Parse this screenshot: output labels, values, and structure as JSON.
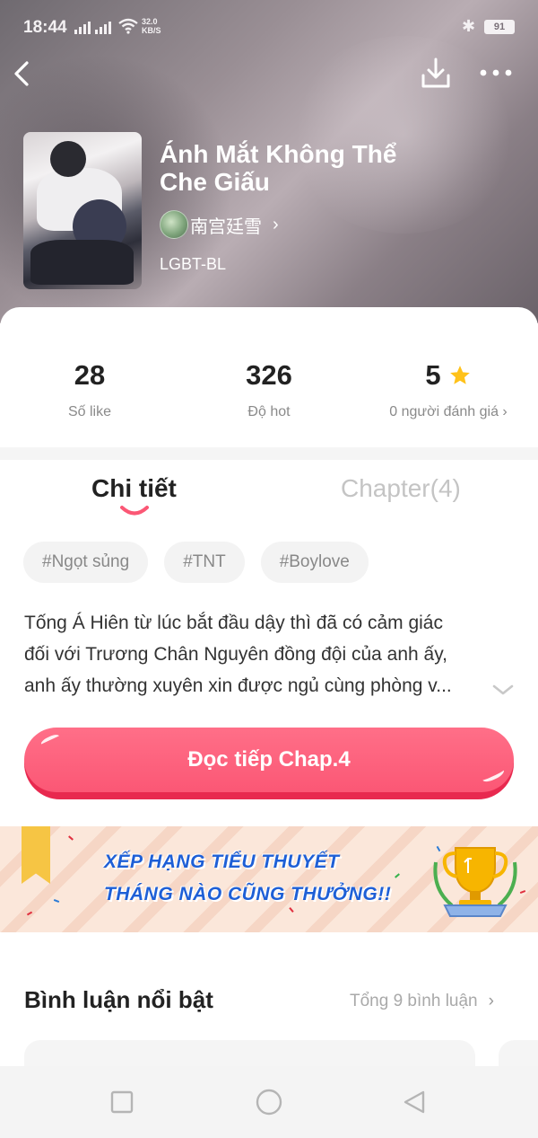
{
  "status_bar": {
    "time": "18:44",
    "net_speed_value": "32.0",
    "net_speed_unit": "KB/S",
    "battery": "91"
  },
  "header": {
    "back_icon": "chevron-left-icon",
    "download_icon": "download-icon",
    "more_icon": "more-dots-icon"
  },
  "book": {
    "title": "Ánh Mắt Không Thể Che Giấu",
    "author": "南宫廷雪",
    "genre": "LGBT-BL"
  },
  "stats": [
    {
      "value": "28",
      "label": "Số like"
    },
    {
      "value": "326",
      "label": "Độ hot"
    },
    {
      "value": "5",
      "label": "0 người đánh giá"
    }
  ],
  "tabs": {
    "details": "Chi tiết",
    "chapters": "Chapter(4)"
  },
  "tags": [
    "#Ngọt sủng",
    "#TNT",
    "#Boylove"
  ],
  "description": [
    "Tống Á Hiên từ lúc bắt đầu dậy thì đã có cảm giác",
    "đối với Trương Chân Nguyên đồng đội của anh ấy,",
    "anh ấy thường xuyên xin được ngủ cùng phòng v..."
  ],
  "read_button": "Đọc tiếp Chap.4",
  "banner": {
    "line1": "XẾP HẠNG TIỂU THUYẾT",
    "line2": "THÁNG NÀO CŨNG THƯỞNG!!"
  },
  "comments": {
    "title": "Bình luận nổi bật",
    "count": "Tổng 9 bình luận"
  },
  "colors": {
    "accent": "#fb5775",
    "banner_text": "#1e5fd6"
  }
}
